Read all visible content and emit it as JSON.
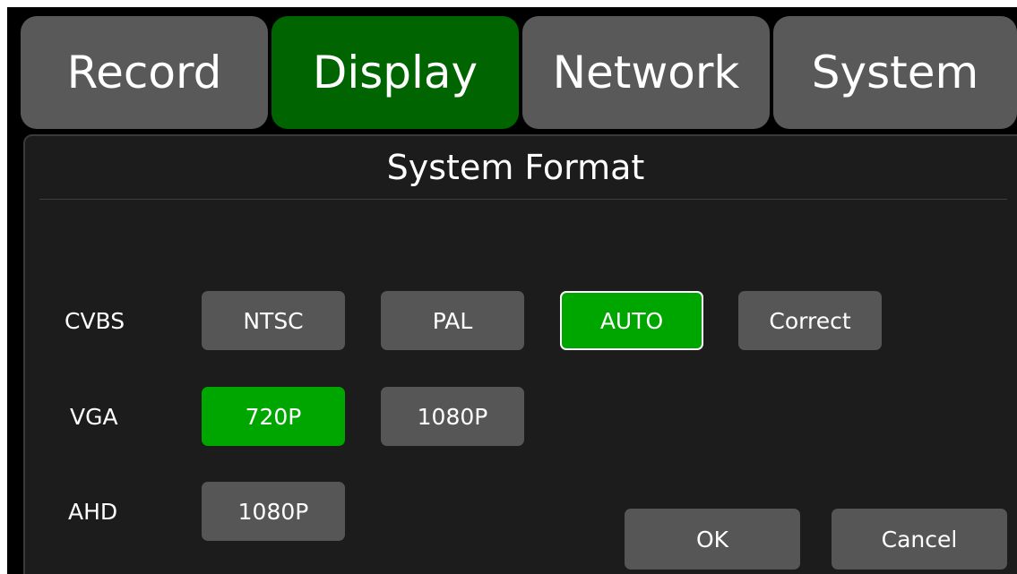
{
  "tabs": [
    {
      "label": "Record",
      "active": false
    },
    {
      "label": "Display",
      "active": true
    },
    {
      "label": "Network",
      "active": false
    },
    {
      "label": "System",
      "active": false
    }
  ],
  "panel": {
    "title": "System Format",
    "rows": [
      {
        "label": "CVBS",
        "options": [
          {
            "label": "NTSC",
            "selected": false
          },
          {
            "label": "PAL",
            "selected": false
          },
          {
            "label": "AUTO",
            "selected": true,
            "focused": true
          },
          {
            "label": "Correct",
            "selected": false
          }
        ]
      },
      {
        "label": "VGA",
        "options": [
          {
            "label": "720P",
            "selected": true
          },
          {
            "label": "1080P",
            "selected": false
          }
        ]
      },
      {
        "label": "AHD",
        "options": [
          {
            "label": "1080P",
            "selected": false
          }
        ]
      }
    ],
    "ok_label": "OK",
    "cancel_label": "Cancel"
  },
  "colors": {
    "active_tab": "#006400",
    "inactive_tab": "#595959",
    "selected_option": "#00a600",
    "option": "#565656",
    "background": "#000000"
  }
}
